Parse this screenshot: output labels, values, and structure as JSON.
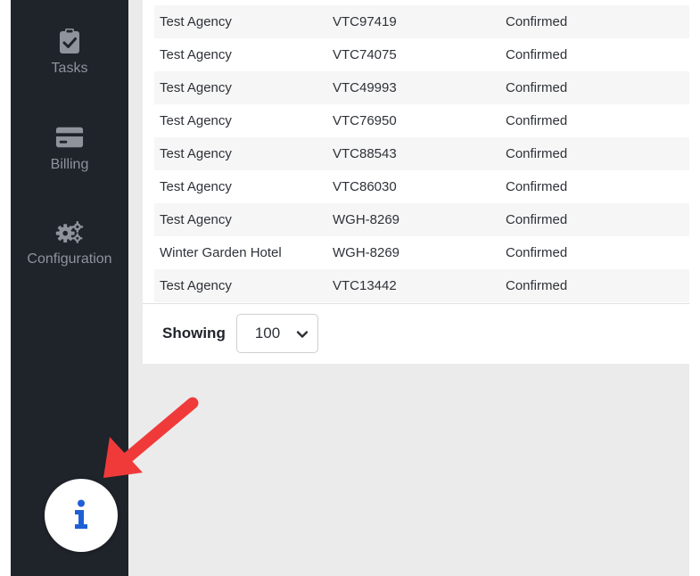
{
  "sidebar": {
    "items": [
      {
        "label": "Tasks",
        "icon": "clipboard-check-icon"
      },
      {
        "label": "Billing",
        "icon": "credit-card-icon"
      },
      {
        "label": "Configuration",
        "icon": "gears-icon"
      }
    ]
  },
  "table": {
    "rows": [
      {
        "agency": "Test Agency",
        "code": "VTC97419",
        "status": "Confirmed"
      },
      {
        "agency": "Test Agency",
        "code": "VTC74075",
        "status": "Confirmed"
      },
      {
        "agency": "Test Agency",
        "code": "VTC49993",
        "status": "Confirmed"
      },
      {
        "agency": "Test Agency",
        "code": "VTC76950",
        "status": "Confirmed"
      },
      {
        "agency": "Test Agency",
        "code": "VTC88543",
        "status": "Confirmed"
      },
      {
        "agency": "Test Agency",
        "code": "VTC86030",
        "status": "Confirmed"
      },
      {
        "agency": "Test Agency",
        "code": "WGH-8269",
        "status": "Confirmed"
      },
      {
        "agency": "Winter Garden Hotel",
        "code": "WGH-8269",
        "status": "Confirmed"
      },
      {
        "agency": "Test Agency",
        "code": "VTC13442",
        "status": "Confirmed"
      }
    ]
  },
  "pager": {
    "label": "Showing",
    "selected": "100"
  },
  "info_button": {
    "glyph": "i",
    "color": "#1f5fd6"
  },
  "colors": {
    "sidebar_bg": "#1f232a",
    "annotation_arrow": "#f03a3a",
    "info_accent": "#1f5fd6"
  }
}
